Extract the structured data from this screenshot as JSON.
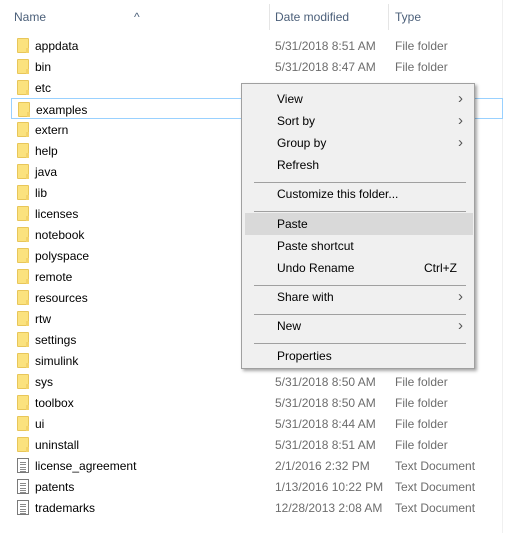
{
  "header": {
    "name": "Name",
    "date": "Date modified",
    "type": "Type",
    "sort": "ascending"
  },
  "files": [
    {
      "name": "appdata",
      "date": "5/31/2018 8:51 AM",
      "type": "File folder",
      "icon": "folder"
    },
    {
      "name": "bin",
      "date": "5/31/2018 8:47 AM",
      "type": "File folder",
      "icon": "folder"
    },
    {
      "name": "etc",
      "date": "",
      "type": "",
      "icon": "folder"
    },
    {
      "name": "examples",
      "date": "",
      "type": "",
      "icon": "folder",
      "selected": true
    },
    {
      "name": "extern",
      "date": "",
      "type": "",
      "icon": "folder"
    },
    {
      "name": "help",
      "date": "",
      "type": "",
      "icon": "folder"
    },
    {
      "name": "java",
      "date": "",
      "type": "",
      "icon": "folder"
    },
    {
      "name": "lib",
      "date": "",
      "type": "",
      "icon": "folder"
    },
    {
      "name": "licenses",
      "date": "",
      "type": "",
      "icon": "folder"
    },
    {
      "name": "notebook",
      "date": "",
      "type": "",
      "icon": "folder"
    },
    {
      "name": "polyspace",
      "date": "",
      "type": "",
      "icon": "folder"
    },
    {
      "name": "remote",
      "date": "",
      "type": "",
      "icon": "folder"
    },
    {
      "name": "resources",
      "date": "",
      "type": "",
      "icon": "folder"
    },
    {
      "name": "rtw",
      "date": "",
      "type": "",
      "icon": "folder"
    },
    {
      "name": "settings",
      "date": "",
      "type": "",
      "icon": "folder"
    },
    {
      "name": "simulink",
      "date": "",
      "type": "",
      "icon": "folder"
    },
    {
      "name": "sys",
      "date": "5/31/2018 8:50 AM",
      "type": "File folder",
      "icon": "folder"
    },
    {
      "name": "toolbox",
      "date": "5/31/2018 8:50 AM",
      "type": "File folder",
      "icon": "folder"
    },
    {
      "name": "ui",
      "date": "5/31/2018 8:44 AM",
      "type": "File folder",
      "icon": "folder"
    },
    {
      "name": "uninstall",
      "date": "5/31/2018 8:51 AM",
      "type": "File folder",
      "icon": "folder"
    },
    {
      "name": "license_agreement",
      "date": "2/1/2016 2:32 PM",
      "type": "Text Document",
      "icon": "text-document"
    },
    {
      "name": "patents",
      "date": "1/13/2016 10:22 PM",
      "type": "Text Document",
      "icon": "text-document"
    },
    {
      "name": "trademarks",
      "date": "12/28/2013 2:08 AM",
      "type": "Text Document",
      "icon": "text-document"
    }
  ],
  "context_menu": [
    {
      "label": "View",
      "submenu": true
    },
    {
      "label": "Sort by",
      "submenu": true
    },
    {
      "label": "Group by",
      "submenu": true
    },
    {
      "label": "Refresh"
    },
    {
      "separator": true
    },
    {
      "label": "Customize this folder..."
    },
    {
      "separator": true
    },
    {
      "label": "Paste",
      "highlighted": true
    },
    {
      "label": "Paste shortcut"
    },
    {
      "label": "Undo Rename",
      "shortcut": "Ctrl+Z"
    },
    {
      "separator": true
    },
    {
      "label": "Share with",
      "submenu": true
    },
    {
      "separator": true
    },
    {
      "label": "New",
      "submenu": true
    },
    {
      "separator": true
    },
    {
      "label": "Properties"
    }
  ]
}
